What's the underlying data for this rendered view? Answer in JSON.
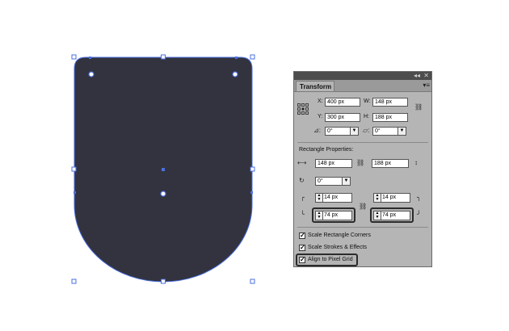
{
  "colors": {
    "shape_fill": "#33333f",
    "selection": "#4a6fe0",
    "panel_bg": "#b5b5b5"
  },
  "panel": {
    "window_controls": [
      "◂◂",
      "✕"
    ],
    "tab_label": "Transform",
    "x_label": "X:",
    "x_value": "400 px",
    "y_label": "Y:",
    "y_value": "300 px",
    "w_label": "W:",
    "w_value": "148 px",
    "h_label": "H:",
    "h_value": "188 px",
    "rotate_value": "0°",
    "shear_value": "0°",
    "rect_heading": "Rectangle Properties:",
    "rect_w_value": "148 px",
    "rect_h_value": "188 px",
    "rect_rotate_value": "0°",
    "corner_tl": "14 px",
    "corner_tr": "14 px",
    "corner_bl": "74 px",
    "corner_br": "74 px",
    "checkboxes": [
      {
        "label": "Scale Rectangle Corners",
        "checked": true
      },
      {
        "label": "Scale Strokes & Effects",
        "checked": true
      },
      {
        "label": "Align to Pixel Grid",
        "checked": true
      }
    ],
    "check_glyph": "✓"
  }
}
